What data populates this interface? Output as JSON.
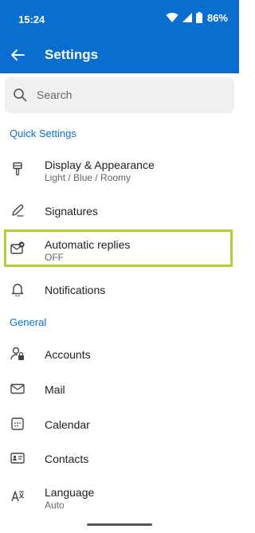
{
  "status_bar": {
    "time": "15:24",
    "battery": "86%"
  },
  "app_bar": {
    "title": "Settings",
    "back_icon": "back-arrow-icon"
  },
  "search": {
    "placeholder": "Search",
    "icon": "search-icon"
  },
  "sections": {
    "quick": "Quick Settings",
    "general": "General"
  },
  "items": {
    "display": {
      "label": "Display & Appearance",
      "subtitle": "Light / Blue / Roomy",
      "icon": "paint-brush-icon"
    },
    "signatures": {
      "label": "Signatures",
      "icon": "pen-icon"
    },
    "auto_replies": {
      "label": "Automatic replies",
      "subtitle": "OFF",
      "icon": "mail-auto-reply-icon"
    },
    "notifications": {
      "label": "Notifications",
      "icon": "bell-icon"
    },
    "accounts": {
      "label": "Accounts",
      "icon": "person-lock-icon"
    },
    "mail": {
      "label": "Mail",
      "icon": "mail-icon"
    },
    "calendar": {
      "label": "Calendar",
      "icon": "calendar-icon"
    },
    "contacts": {
      "label": "Contacts",
      "icon": "contact-card-icon"
    },
    "language": {
      "label": "Language",
      "subtitle": "Auto",
      "icon": "language-icon"
    }
  },
  "colors": {
    "brand": "#0a6ed1",
    "highlight": "#b8ce31"
  }
}
